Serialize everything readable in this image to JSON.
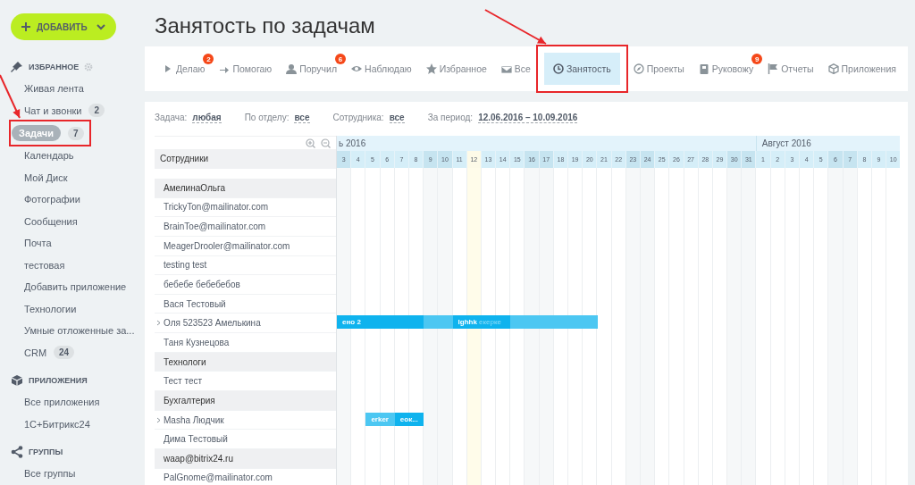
{
  "sidebar": {
    "add_button": "ДОБАВИТЬ",
    "sections": [
      {
        "title": "ИЗБРАННОЕ",
        "kind": "favorites",
        "items": [
          {
            "label": "Живая лента",
            "selected": false,
            "highlighted": false
          },
          {
            "label": "Чат и звонки",
            "count": "2",
            "selected": false,
            "highlighted": false
          },
          {
            "label": "Задачи",
            "count": "7",
            "selected": true,
            "highlighted": true
          },
          {
            "label": "Календарь",
            "selected": false,
            "highlighted": false
          },
          {
            "label": "Мой Диск",
            "selected": false,
            "highlighted": false
          },
          {
            "label": "Фотографии",
            "selected": false,
            "highlighted": false
          },
          {
            "label": "Сообщения",
            "selected": false,
            "highlighted": false
          },
          {
            "label": "Почта",
            "selected": false,
            "highlighted": false
          },
          {
            "label": "тестовая",
            "selected": false,
            "highlighted": false
          },
          {
            "label": "Добавить приложение",
            "selected": false,
            "highlighted": false
          },
          {
            "label": "Технологии",
            "selected": false,
            "highlighted": false
          },
          {
            "label": "Умные отложенные за...",
            "selected": false,
            "highlighted": false
          },
          {
            "label": "CRM",
            "count": "24",
            "selected": false,
            "highlighted": false
          }
        ]
      },
      {
        "title": "ПРИЛОЖЕНИЯ",
        "kind": "apps",
        "items": [
          {
            "label": "Все приложения",
            "selected": false,
            "highlighted": false
          },
          {
            "label": "1С+Битрикс24",
            "selected": false,
            "highlighted": false
          }
        ]
      },
      {
        "title": "ГРУППЫ",
        "kind": "groups",
        "items": [
          {
            "label": "Все группы",
            "selected": false,
            "highlighted": false
          }
        ]
      }
    ]
  },
  "page_title": "Занятость по задачам",
  "tabs": [
    {
      "label": "Делаю",
      "kind": "play",
      "badge": "2",
      "selected": false,
      "highlighted": false
    },
    {
      "label": "Помогаю",
      "kind": "arrow",
      "selected": false,
      "highlighted": false
    },
    {
      "label": "Поручил",
      "kind": "person",
      "badge": "6",
      "selected": false,
      "highlighted": false
    },
    {
      "label": "Наблюдаю",
      "kind": "eye",
      "selected": false,
      "highlighted": false
    },
    {
      "label": "Избранное",
      "kind": "star",
      "selected": false,
      "highlighted": false
    },
    {
      "label": "Все",
      "kind": "inbox",
      "selected": false,
      "highlighted": false
    },
    {
      "label": "Занятость",
      "kind": "clock",
      "selected": true,
      "highlighted": true
    },
    {
      "label": "Проекты",
      "kind": "compass",
      "selected": false,
      "highlighted": false
    },
    {
      "label": "Руковожу",
      "kind": "book",
      "badge": "9",
      "selected": false,
      "highlighted": false
    },
    {
      "label": "Отчеты",
      "kind": "flag",
      "selected": false,
      "highlighted": false
    },
    {
      "label": "Приложения",
      "kind": "cube",
      "selected": false,
      "highlighted": false
    }
  ],
  "filters": [
    {
      "label": "Задача:",
      "value": "любая"
    },
    {
      "label": "По отделу:",
      "value": "все"
    },
    {
      "label": "Сотрудника:",
      "value": "все"
    },
    {
      "label": "За период:",
      "value": "12.06.2016 – 10.09.2016"
    }
  ],
  "gantt": {
    "column_header": "Сотрудники",
    "months": [
      {
        "label": "ь 2016",
        "days": [
          {
            "label": "3",
            "kind": "weekend"
          },
          {
            "label": "4",
            "kind": "workday"
          },
          {
            "label": "5",
            "kind": "workday"
          },
          {
            "label": "6",
            "kind": "workday"
          },
          {
            "label": "7",
            "kind": "workday"
          },
          {
            "label": "8",
            "kind": "workday"
          },
          {
            "label": "9",
            "kind": "weekend"
          },
          {
            "label": "10",
            "kind": "weekend"
          },
          {
            "label": "11",
            "kind": "workday"
          },
          {
            "label": "12",
            "kind": "today"
          },
          {
            "label": "13",
            "kind": "workday"
          },
          {
            "label": "14",
            "kind": "workday"
          },
          {
            "label": "15",
            "kind": "workday"
          },
          {
            "label": "16",
            "kind": "weekend"
          },
          {
            "label": "17",
            "kind": "weekend"
          },
          {
            "label": "18",
            "kind": "workday"
          },
          {
            "label": "19",
            "kind": "workday"
          },
          {
            "label": "20",
            "kind": "workday"
          },
          {
            "label": "21",
            "kind": "workday"
          },
          {
            "label": "22",
            "kind": "workday"
          },
          {
            "label": "23",
            "kind": "weekend"
          },
          {
            "label": "24",
            "kind": "weekend"
          },
          {
            "label": "25",
            "kind": "workday"
          },
          {
            "label": "26",
            "kind": "workday"
          },
          {
            "label": "27",
            "kind": "workday"
          },
          {
            "label": "28",
            "kind": "workday"
          },
          {
            "label": "29",
            "kind": "workday"
          },
          {
            "label": "30",
            "kind": "weekend"
          },
          {
            "label": "31",
            "kind": "weekend"
          }
        ]
      },
      {
        "label": "Август 2016",
        "days": [
          {
            "label": "1",
            "kind": "workday"
          },
          {
            "label": "2",
            "kind": "workday"
          },
          {
            "label": "3",
            "kind": "workday"
          },
          {
            "label": "4",
            "kind": "workday"
          },
          {
            "label": "5",
            "kind": "workday"
          },
          {
            "label": "6",
            "kind": "weekend"
          },
          {
            "label": "7",
            "kind": "weekend"
          },
          {
            "label": "8",
            "kind": "workday"
          },
          {
            "label": "9",
            "kind": "workday"
          },
          {
            "label": "10",
            "kind": "workday"
          }
        ]
      }
    ],
    "rows": [
      {
        "kind": "spacer"
      },
      {
        "kind": "group",
        "label": "АмелинаОльга"
      },
      {
        "kind": "person",
        "label": "TrickyTon@mailinator.com",
        "expandable": false
      },
      {
        "kind": "person",
        "label": "BrainToe@mailinator.com",
        "expandable": false
      },
      {
        "kind": "person",
        "label": "MeagerDrooler@mailinator.com",
        "expandable": false
      },
      {
        "kind": "person",
        "label": "testing test",
        "expandable": false
      },
      {
        "kind": "person",
        "label": "бебебе бебебебов",
        "expandable": false
      },
      {
        "kind": "person",
        "label": "Вася Тестовый",
        "expandable": false
      },
      {
        "kind": "person",
        "label": "Оля 523523 Амелькина",
        "expandable": true,
        "bars": [
          {
            "kind": "dark",
            "label": "ено 2"
          },
          {
            "kind": "light"
          },
          {
            "kind": "dark",
            "label": "lghhk",
            "faded_label": "екерке"
          },
          {
            "kind": "light"
          }
        ]
      },
      {
        "kind": "person",
        "label": "Таня Кузнецова",
        "expandable": false
      },
      {
        "kind": "group",
        "label": "Технологи"
      },
      {
        "kind": "person",
        "label": "Тест тест",
        "expandable": false
      },
      {
        "kind": "group",
        "label": "Бухгалтерия"
      },
      {
        "kind": "person",
        "label": "Masha Людчик",
        "expandable": true,
        "bars": [
          {
            "kind": "light",
            "label": "erker"
          },
          {
            "kind": "dark",
            "label": "еок..."
          }
        ]
      },
      {
        "kind": "person",
        "label": "Дима Тестовый",
        "expandable": false
      },
      {
        "kind": "group",
        "label": "waap@bitrix24.ru"
      },
      {
        "kind": "person",
        "label": "PalGnome@mailinator.com",
        "expandable": false
      }
    ]
  }
}
